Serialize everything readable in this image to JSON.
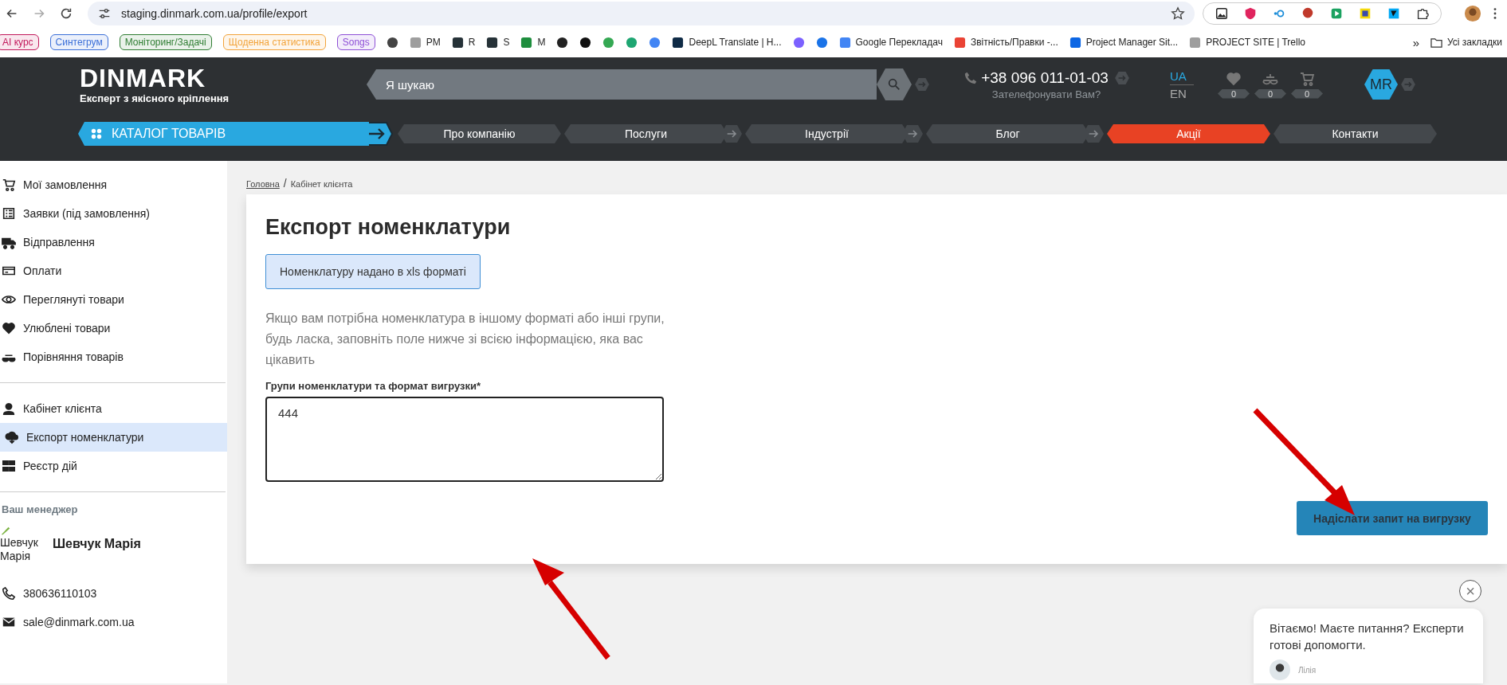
{
  "browser": {
    "url": "staging.dinmark.com.ua/profile/export",
    "bookmarks": [
      {
        "kind": "chip",
        "label": "AI курс",
        "color": "#c2185b"
      },
      {
        "kind": "chip",
        "label": "Синтегрум",
        "color": "#3b6fd8"
      },
      {
        "kind": "chip",
        "label": "Моніторинг/Задачі",
        "color": "#2e7d32"
      },
      {
        "kind": "chip",
        "label": "Щоденна статистика",
        "color": "#f2a33a"
      },
      {
        "kind": "chip",
        "label": "Songs",
        "color": "#8e4fd6"
      },
      {
        "kind": "icon",
        "color": "#444444"
      },
      {
        "kind": "link",
        "label": "PM",
        "color": "#9e9e9e"
      },
      {
        "kind": "link",
        "label": "R",
        "color": "#263238"
      },
      {
        "kind": "link",
        "label": "S",
        "color": "#263238"
      },
      {
        "kind": "link",
        "label": "M",
        "color": "#1e8e3e"
      },
      {
        "kind": "icon",
        "color": "#222222"
      },
      {
        "kind": "icon",
        "color": "#111111"
      },
      {
        "kind": "icon",
        "color": "#34a853"
      },
      {
        "kind": "icon",
        "color": "#1ea672"
      },
      {
        "kind": "icon",
        "color": "#4285f4"
      },
      {
        "kind": "link",
        "label": "DeepL Translate | Н...",
        "color": "#0f2b46"
      },
      {
        "kind": "icon",
        "color": "#7b61ff"
      },
      {
        "kind": "icon",
        "color": "#1a73e8"
      },
      {
        "kind": "link",
        "label": "Google Перекладач",
        "color": "#4285f4"
      },
      {
        "kind": "link",
        "label": "Звітність/Правки -...",
        "color": "#ea4335"
      },
      {
        "kind": "link",
        "label": "Project Manager Sit...",
        "color": "#0c66e4"
      },
      {
        "kind": "link",
        "label": "PROJECT SITE | Trello",
        "color": "#9e9e9e"
      }
    ],
    "more": "»",
    "all_bookmarks": "Усі закладки"
  },
  "header": {
    "logo": "DINMARK",
    "tagline": "Експерт з якісного кріплення",
    "search": {
      "placeholder": "Я шукаю"
    },
    "phone": "+38 096 011-01-03",
    "callback": "Зателефонувати Вам?",
    "languages": [
      {
        "label": "UA",
        "selected": true
      },
      {
        "label": "EN",
        "selected": false
      }
    ],
    "counters": [
      {
        "kind": "heart",
        "count": "0"
      },
      {
        "kind": "scale",
        "count": "0"
      },
      {
        "kind": "cart",
        "count": "0"
      }
    ],
    "avatar": "MR"
  },
  "nav": {
    "catalog": "КАТАЛОГ ТОВАРІВ",
    "items": [
      {
        "label": "Про компанію",
        "arrow": false,
        "highlight": false
      },
      {
        "label": "Послуги",
        "arrow": true,
        "highlight": false
      },
      {
        "label": "Індустрії",
        "arrow": true,
        "highlight": false
      },
      {
        "label": "Блог",
        "arrow": true,
        "highlight": false
      },
      {
        "label": "Акції",
        "arrow": false,
        "highlight": true
      },
      {
        "label": "Контакти",
        "arrow": false,
        "highlight": false
      }
    ]
  },
  "sidebar": {
    "groups": [
      [
        {
          "label": "Мої замовлення",
          "selected": false
        },
        {
          "label": "Заявки (під замовлення)",
          "selected": false
        },
        {
          "label": "Відправлення",
          "selected": false
        },
        {
          "label": "Оплати",
          "selected": false
        },
        {
          "label": "Переглянуті товари",
          "selected": false
        },
        {
          "label": "Улюблені товари",
          "selected": false
        },
        {
          "label": "Порівняння товарів",
          "selected": false
        }
      ],
      [
        {
          "label": "Кабінет клієнта",
          "selected": false
        },
        {
          "label": "Експорт номенклатури",
          "selected": true
        },
        {
          "label": "Реєстр дій",
          "selected": false
        }
      ]
    ],
    "manager": {
      "heading": "Ваш менеджер",
      "photo_alt": "Шевчук Марія",
      "name": "Шевчук Марія",
      "phone": "380636110103",
      "email": "sale@dinmark.com.ua"
    }
  },
  "breadcrumb": {
    "separator": "/",
    "items": [
      {
        "label": "Головна",
        "link": true
      },
      {
        "label": "Кабінет клієнта",
        "link": false
      }
    ]
  },
  "content": {
    "title": "Експорт номенклатури",
    "notice": "Номенклатуру надано в xls форматі",
    "description": "Якщо вам потрібна номенклатура в іншому форматі або інші групи, будь ласка, заповніть поле нижче зі всією інформацією, яка вас цікавить",
    "field": {
      "label": "Групи номенклатури та формат вигрузки*",
      "value": "444"
    },
    "submit": "Надіслати запит на вигрузку"
  },
  "chat": {
    "close": "×",
    "message": "Вітаємо! Маєте питання? Експерти готові допомогти.",
    "agent": "Лілія"
  }
}
